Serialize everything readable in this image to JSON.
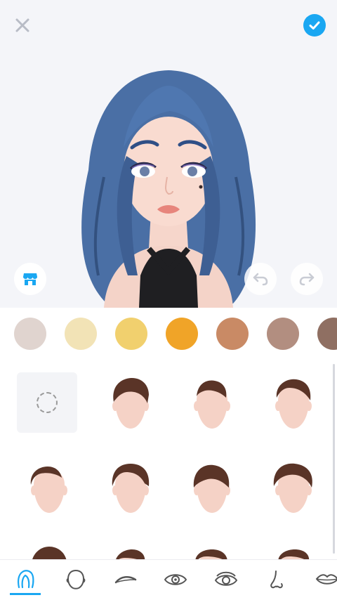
{
  "toolbar": {
    "close_icon": "close-x-icon",
    "confirm_icon": "check-circle-icon",
    "accent_color": "#1aa7f2"
  },
  "preview": {
    "left_button_icon": "store-icon",
    "undo_icon": "undo-icon",
    "redo_icon": "redo-icon",
    "hair_color": "#4a6fa5"
  },
  "color_swatches": [
    "#e0d4cf",
    "#f2e3b6",
    "#f1d06e",
    "#f0a428",
    "#c98a65",
    "#b28e80",
    "#8f6f62"
  ],
  "styles": {
    "none_option": "no-hair-icon",
    "hair_color": "#5a3427",
    "items": [
      "hair-style-1",
      "hair-style-2",
      "hair-style-3",
      "hair-style-4",
      "hair-style-5",
      "hair-style-6",
      "hair-style-7",
      "hair-style-8",
      "hair-style-9",
      "hair-style-10",
      "hair-style-11"
    ]
  },
  "nav": {
    "active_tab": "hair",
    "tabs": [
      "hair-icon",
      "face-shape-icon",
      "eyebrow-icon",
      "eye-icon",
      "eye-detail-icon",
      "nose-icon",
      "lips-icon"
    ]
  }
}
